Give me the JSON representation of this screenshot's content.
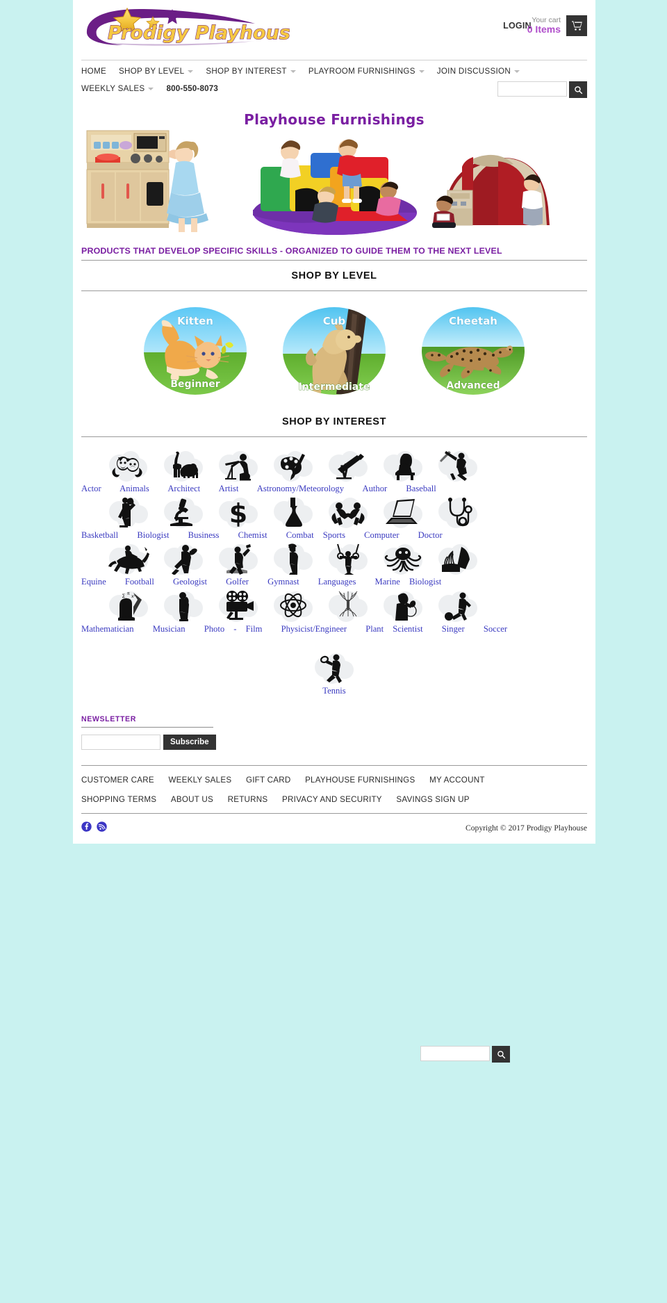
{
  "site": {
    "name": "Prodigy Playhouse",
    "logo_text_1": "Prod",
    "logo_text_2": "gy Playhouse",
    "brand_purple": "#7A1FA2",
    "brand_gold": "#F2C53D",
    "accent_blue": "#3a3ac0",
    "page_bg": "#c9f2f0"
  },
  "header": {
    "login_label": "LOGIN",
    "cart_label": "Your cart",
    "cart_count": "0 Items",
    "cart_icon": "shopping-cart-icon"
  },
  "nav": {
    "row1": [
      {
        "label": "HOME",
        "caret": false
      },
      {
        "label": "SHOP BY LEVEL",
        "caret": true
      },
      {
        "label": "SHOP BY INTEREST",
        "caret": true
      },
      {
        "label": "PLAYROOM FURNISHINGS",
        "caret": true
      },
      {
        "label": "JOIN DISCUSSION",
        "caret": true
      }
    ],
    "row2": [
      {
        "label": "WEEKLY SALES",
        "caret": true
      }
    ],
    "phone": "800-550-8073"
  },
  "search": {
    "value": "",
    "placeholder": "",
    "icon": "search-icon"
  },
  "bottom_search": {
    "value": "",
    "placeholder": "",
    "icon": "search-icon"
  },
  "banner": {
    "title": "Playhouse Furnishings",
    "images": [
      "play-kitchen-with-girl",
      "soft-play-climbing-blocks-with-toddlers",
      "red-canopy-play-tent-with-children"
    ]
  },
  "tagline": "PRODUCTS THAT DEVELOP SPECIFIC SKILLS - ORGANIZED TO GUIDE THEM TO THE NEXT LEVEL",
  "shop_by_level": {
    "heading": "SHOP BY LEVEL",
    "items": [
      {
        "animal": "Kitten",
        "level": "Beginner",
        "icon": "kitten-circle-icon"
      },
      {
        "animal": "Cub",
        "level": "Intermediate",
        "icon": "cub-circle-icon"
      },
      {
        "animal": "Cheetah",
        "level": "Advanced",
        "icon": "cheetah-circle-icon"
      }
    ]
  },
  "shop_by_interest": {
    "heading": "SHOP BY INTEREST",
    "rows": [
      {
        "icons": [
          "theater-masks-icon",
          "giraffe-elephant-icon",
          "drafting-architect-icon",
          "artist-palette-icon",
          "telescope-icon",
          "writer-at-desk-icon",
          "baseball-batter-icon"
        ],
        "labels": [
          "Actor",
          "Animals",
          "Architect",
          "Artist",
          "Astronomy/Meteorology",
          "Author",
          "Baseball"
        ]
      },
      {
        "icons": [
          "basketball-player-icon",
          "microscope-icon",
          "dollar-sign-icon",
          "erlenmeyer-flask-icon",
          "wrestlers-icon",
          "laptop-icon",
          "stethoscope-icon"
        ],
        "labels": [
          "Basketball",
          "Biologist",
          "Business",
          "Chemist",
          "Combat Sports",
          "Computer",
          "Doctor"
        ]
      },
      {
        "icons": [
          "horse-rider-icon",
          "football-player-icon",
          "rock-hammer-icon",
          "golfer-icon",
          "gymnast-rings-icon",
          "octopus-icon",
          "coral-diver-icon"
        ],
        "labels": [
          "Equine",
          "Football",
          "Geologist",
          "Golfer",
          "Gymnast",
          "Languages",
          "Marine Biologist"
        ]
      },
      {
        "icons": [
          "math-head-icon",
          "saxophone-player-icon",
          "film-camera-icon",
          "atom-icon",
          "tree-roots-icon",
          "singer-microphone-icon",
          "soccer-player-icon"
        ],
        "labels": [
          "Mathematician",
          "Musician",
          "Photo - Film",
          "Physicist/Engineer",
          "Plant Scientist",
          "Singer",
          "Soccer"
        ]
      },
      {
        "icons": [
          "tennis-player-icon"
        ],
        "labels": [
          "Tennis"
        ]
      }
    ]
  },
  "newsletter": {
    "title": "NEWSLETTER",
    "input_value": "",
    "input_placeholder": "",
    "button_label": "Subscribe"
  },
  "footer": {
    "row1": [
      "CUSTOMER CARE",
      "WEEKLY SALES",
      "GIFT CARD",
      "PLAYHOUSE FURNISHINGS",
      "MY ACCOUNT"
    ],
    "row2": [
      "SHOPPING TERMS",
      "ABOUT US",
      "RETURNS",
      "PRIVACY AND SECURITY",
      "SAVINGS SIGN UP"
    ],
    "social": [
      "facebook-icon",
      "rss-icon"
    ],
    "copyright": "Copyright © 2017 Prodigy Playhouse"
  }
}
